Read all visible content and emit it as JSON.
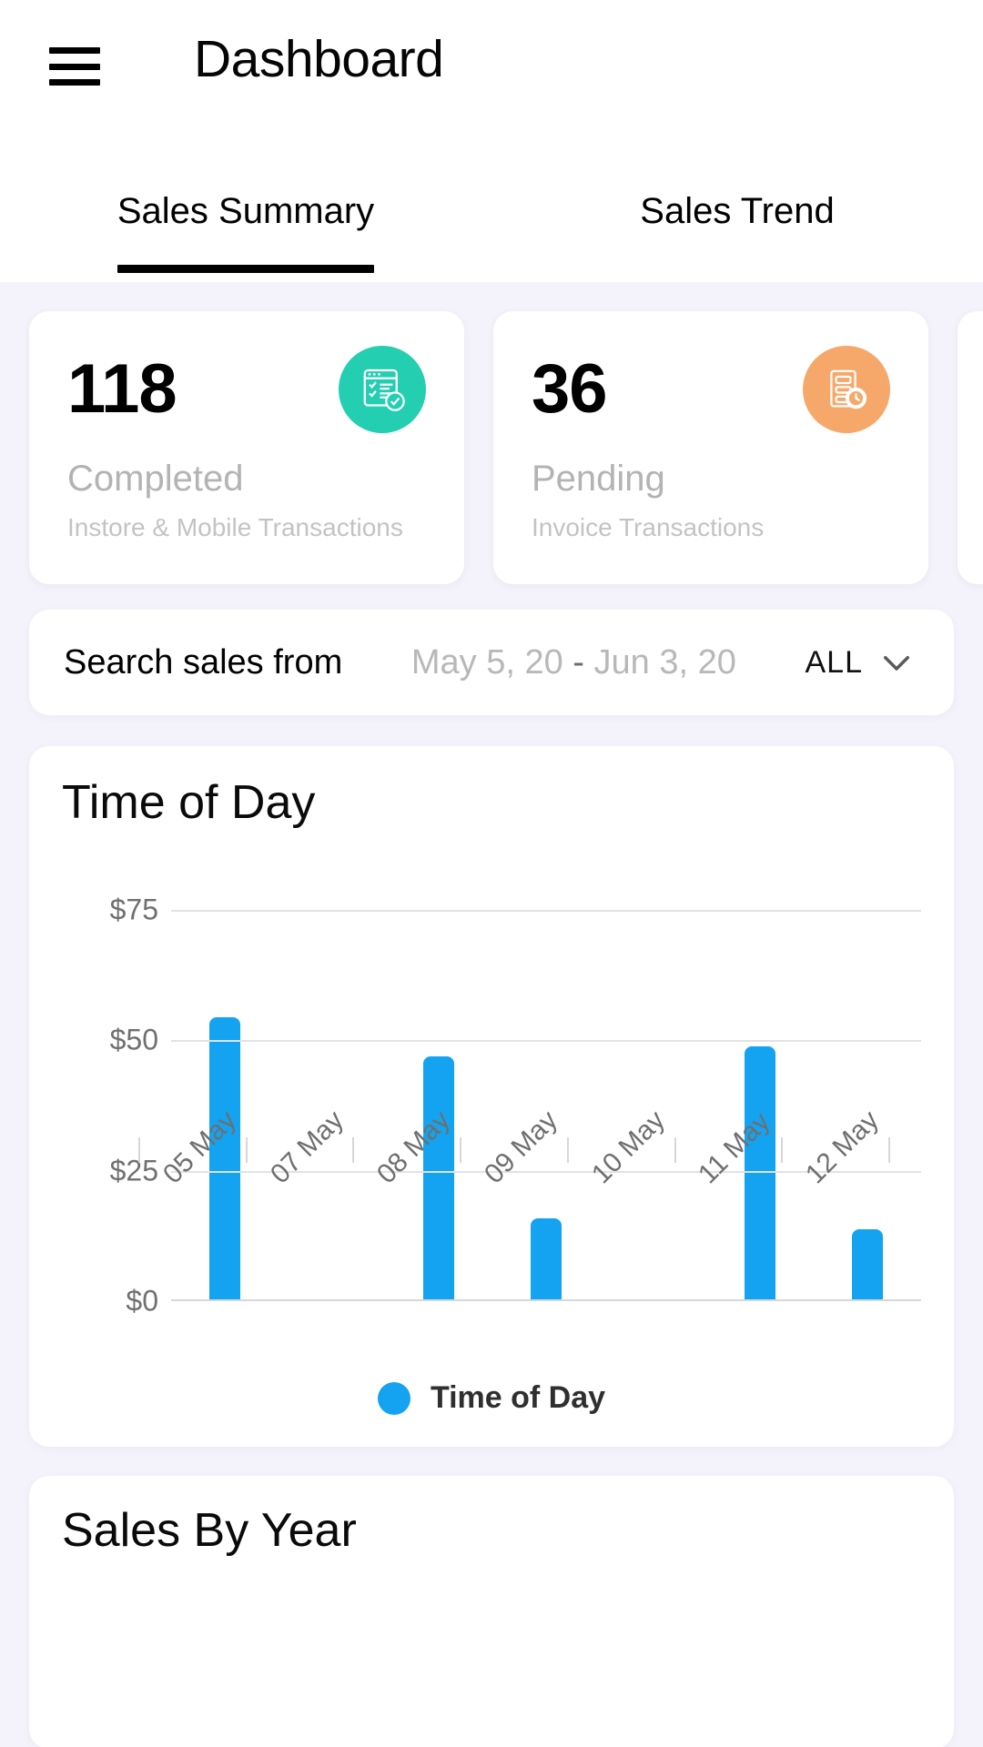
{
  "header": {
    "title": "Dashboard",
    "menu_icon": "hamburger-menu-icon"
  },
  "tabs": [
    {
      "label": "Sales Summary",
      "active": true
    },
    {
      "label": "Sales Trend",
      "active": false
    }
  ],
  "stat_cards": [
    {
      "value": "118",
      "title": "Completed",
      "subtitle": "Instore & Mobile Transactions",
      "icon": "checklist-document-icon",
      "icon_bg": "#23ceb1"
    },
    {
      "value": "36",
      "title": "Pending",
      "subtitle": "Invoice Transactions",
      "icon": "invoice-clock-icon",
      "icon_bg": "#f6a86a"
    },
    {
      "value": "",
      "title": "",
      "subtitle": "",
      "icon": "",
      "icon_bg": "#ffffff"
    }
  ],
  "search": {
    "label": "Search sales from",
    "date_range_start": "May 5, 20",
    "date_range_separator": "-",
    "date_range_end": "Jun 3, 20",
    "filter_value": "ALL",
    "chevron_icon": "chevron-down-icon"
  },
  "bottom_card": {
    "title": "Sales By Year"
  },
  "chart_data": {
    "type": "bar",
    "title": "Time of Day",
    "categories": [
      "05 May",
      "07 May",
      "08 May",
      "09 May",
      "10 May",
      "11 May",
      "12 May"
    ],
    "values": [
      54,
      0,
      46.5,
      15.5,
      0,
      48.5,
      13.5
    ],
    "series": [
      {
        "name": "Time of Day",
        "values": [
          54,
          0,
          46.5,
          15.5,
          0,
          48.5,
          13.5
        ],
        "color": "#14a3f0"
      }
    ],
    "ytick_labels": [
      "$75",
      "$50",
      "$25",
      "$0"
    ],
    "ytick_values": [
      75,
      50,
      25,
      0
    ],
    "ylim": [
      0,
      75
    ],
    "xlabel": "",
    "ylabel": "",
    "grid": true,
    "legend": [
      {
        "label": "Time of Day",
        "color": "#14a3f0"
      }
    ],
    "legend_position": "bottom"
  }
}
